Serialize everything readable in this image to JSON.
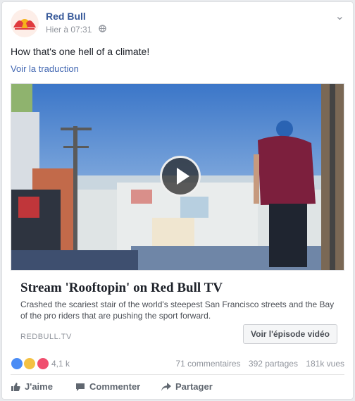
{
  "page": {
    "name": "Red Bull",
    "date": "Hier à 07:31",
    "globe_icon": "globe-icon"
  },
  "post": {
    "text": "How that's one hell of a climate!",
    "link": "Voir la traduction"
  },
  "link_preview": {
    "title": "Stream 'Rooftopin' on Red Bull TV",
    "description": "Crashed the scariest stair of the world's steepest San Francisco streets and the Bay of the pro riders that are pushing the sport forward.",
    "source": "REDBULL.TV",
    "cta": "Voir l'épisode vidéo"
  },
  "reactions": {
    "count": "4,1 k",
    "colors": [
      "#4a8cf5",
      "#f4c142",
      "#f04e6e"
    ],
    "stats": [
      "71 commentaires",
      "392 partages",
      "181k vues"
    ]
  },
  "actions": {
    "like": "J'aime",
    "comment": "Commenter",
    "share": "Partager"
  }
}
